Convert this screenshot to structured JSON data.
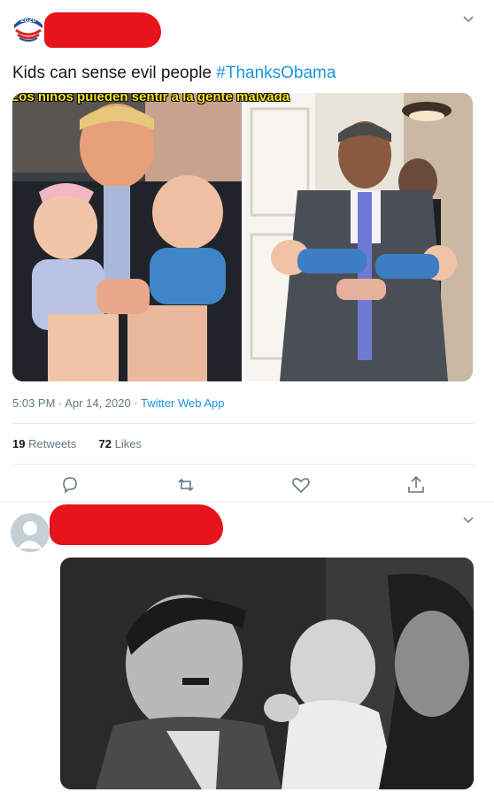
{
  "tweet1": {
    "text": "Kids can sense evil people ",
    "hashtag": "#ThanksObama",
    "image_caption": "Los niños puieden sentir a la gente malvada",
    "time": "5:03 PM",
    "date": "Apr 14, 2020",
    "separator": " · ",
    "app": "Twitter Web App",
    "retweets_count": "19",
    "retweets_label": "Retweets",
    "likes_count": "72",
    "likes_label": "Likes",
    "avatar_icon": "logo-avatar-icon",
    "avatar_logo_text": "2020"
  },
  "tweet2": {
    "avatar_icon": "default-profile-icon"
  },
  "icons": [
    "reply-icon",
    "retweet-icon",
    "like-icon",
    "share-icon",
    "chevron-down-icon"
  ],
  "colors": {
    "accent": "#1b95e0",
    "redaction": "#e8141b",
    "caption": "#f4e81c",
    "icon": "#657786"
  }
}
